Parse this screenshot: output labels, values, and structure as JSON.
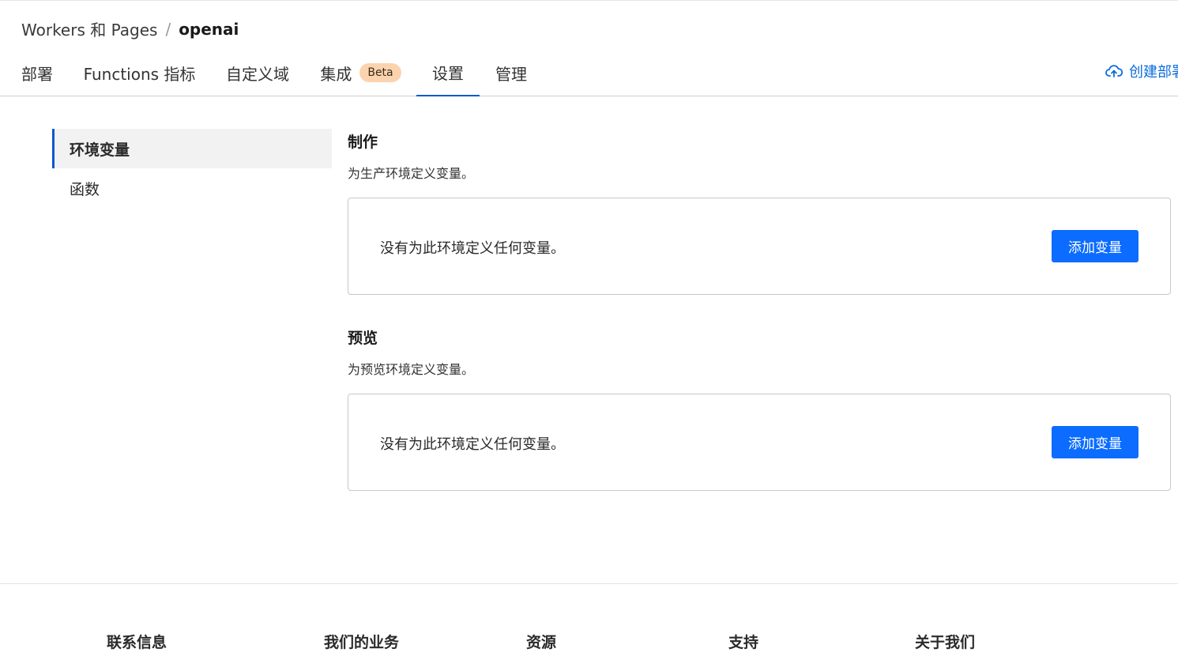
{
  "breadcrumb": {
    "parent": "Workers 和 Pages",
    "separator": "/",
    "current": "openai"
  },
  "tabs": [
    {
      "label": "部署"
    },
    {
      "label": "Functions 指标"
    },
    {
      "label": "自定义域"
    },
    {
      "label": "集成",
      "badge": "Beta"
    },
    {
      "label": "设置",
      "active": true
    },
    {
      "label": "管理"
    }
  ],
  "header_action": {
    "label": "创建部署",
    "icon": "cloud-upload-icon"
  },
  "side_nav": {
    "items": [
      {
        "label": "环境变量",
        "active": true
      },
      {
        "label": "函数"
      }
    ]
  },
  "sections": {
    "production": {
      "title": "制作",
      "description": "为生产环境定义变量。",
      "empty_text": "没有为此环境定义任何变量。",
      "button": "添加变量"
    },
    "preview": {
      "title": "预览",
      "description": "为预览环境定义变量。",
      "empty_text": "没有为此环境定义任何变量。",
      "button": "添加变量"
    }
  },
  "footer": {
    "headings": [
      "联系信息",
      "我们的业务",
      "资源",
      "支持",
      "关于我们"
    ]
  },
  "colors": {
    "accent": "#0b57d0",
    "button": "#0b6cff",
    "badge": "#fbd3ae"
  }
}
